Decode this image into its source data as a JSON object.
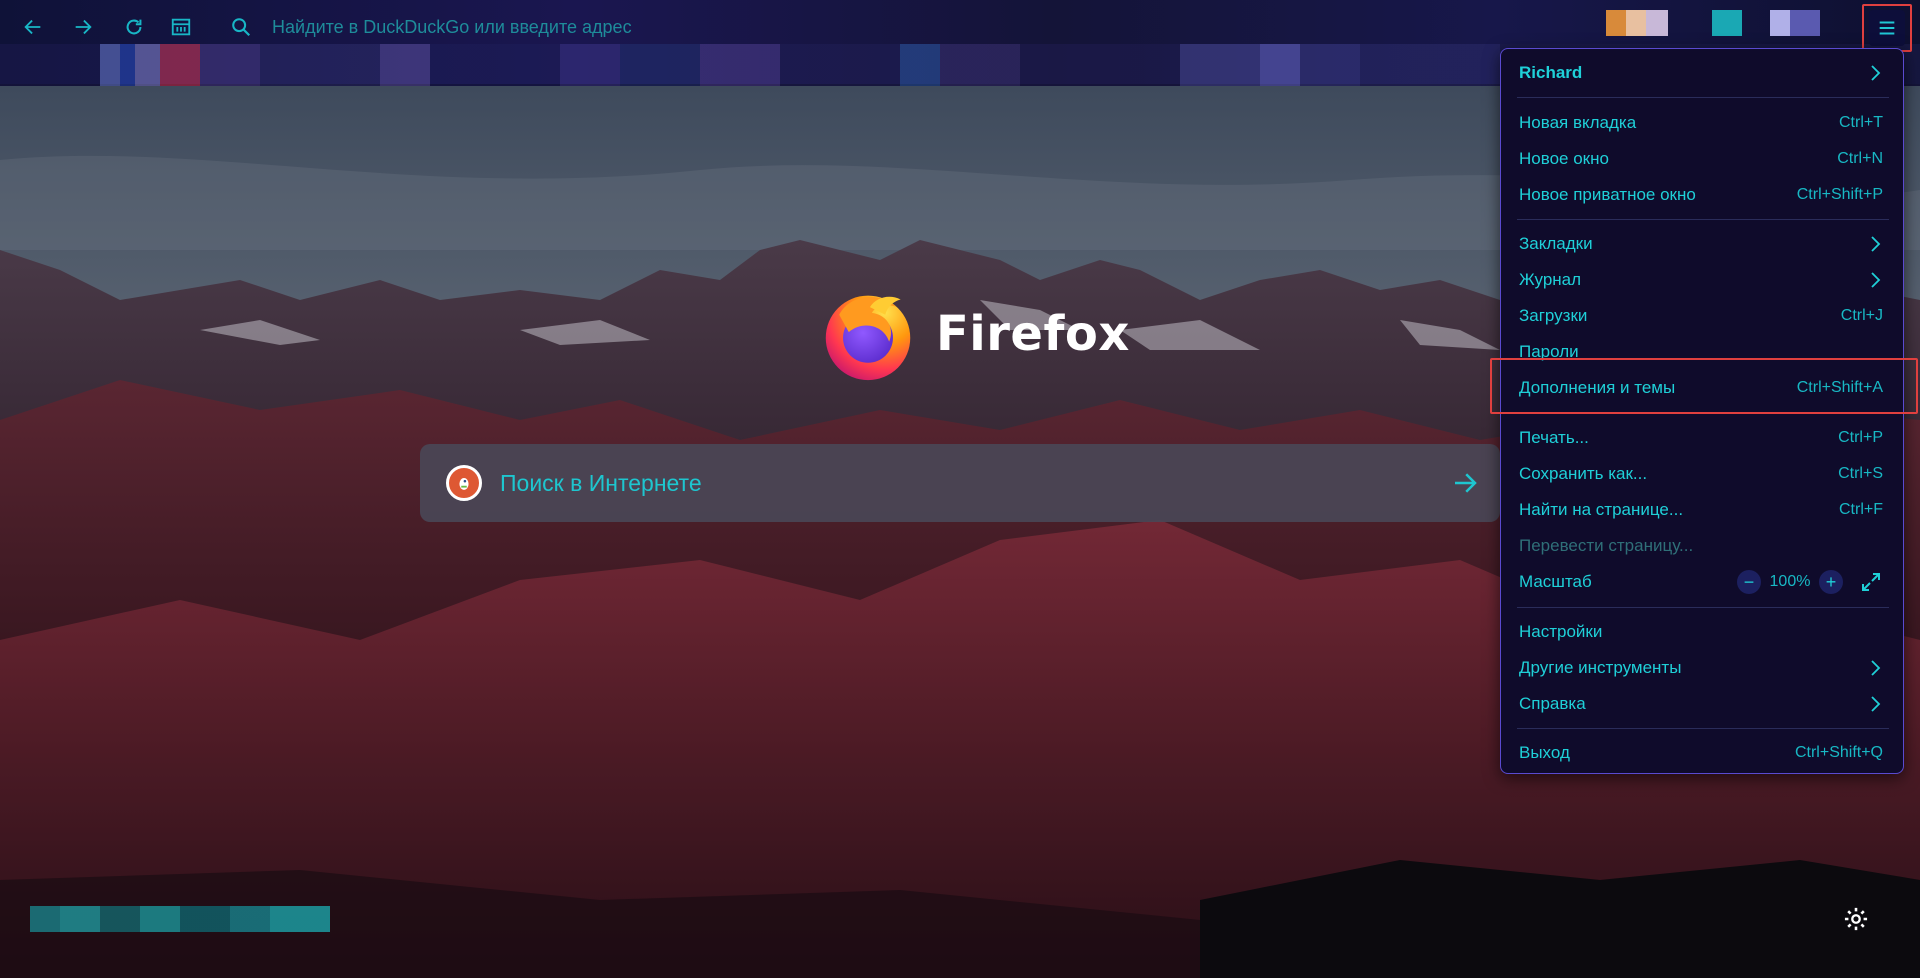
{
  "toolbar": {
    "url_placeholder": "Найдите в DuckDuckGo или введите адрес"
  },
  "brand": {
    "name": "Firefox"
  },
  "search": {
    "placeholder": "Поиск в Интернете"
  },
  "menu": {
    "account": "Richard",
    "items": {
      "new_tab": {
        "label": "Новая вкладка",
        "shortcut": "Ctrl+T"
      },
      "new_window": {
        "label": "Новое окно",
        "shortcut": "Ctrl+N"
      },
      "private_window": {
        "label": "Новое приватное окно",
        "shortcut": "Ctrl+Shift+P"
      },
      "bookmarks": {
        "label": "Закладки"
      },
      "history": {
        "label": "Журнал"
      },
      "downloads": {
        "label": "Загрузки",
        "shortcut": "Ctrl+J"
      },
      "passwords": {
        "label": "Пароли"
      },
      "addons": {
        "label": "Дополнения и темы",
        "shortcut": "Ctrl+Shift+A"
      },
      "print": {
        "label": "Печать...",
        "shortcut": "Ctrl+P"
      },
      "save_as": {
        "label": "Сохранить как...",
        "shortcut": "Ctrl+S"
      },
      "find": {
        "label": "Найти на странице...",
        "shortcut": "Ctrl+F"
      },
      "translate": {
        "label": "Перевести страницу..."
      },
      "zoom": {
        "label": "Масштаб",
        "value": "100%",
        "minus": "−",
        "plus": "+"
      },
      "settings": {
        "label": "Настройки"
      },
      "more_tools": {
        "label": "Другие инструменты"
      },
      "help": {
        "label": "Справка"
      },
      "quit": {
        "label": "Выход",
        "shortcut": "Ctrl+Shift+Q"
      }
    }
  },
  "colors": {
    "accent": "#1fd0d8",
    "panel_bg": "#0f0b2b",
    "highlight": "#e0403f"
  }
}
